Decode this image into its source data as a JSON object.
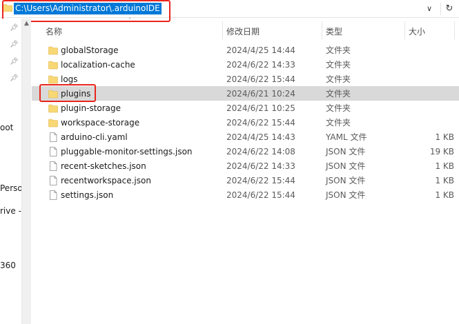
{
  "address": {
    "path": "C:\\Users\\Administrator\\.arduinoIDE"
  },
  "nav": {
    "items": [
      {
        "label": "oot"
      },
      {
        "label": "Perso"
      },
      {
        "label": "rive -"
      },
      {
        "label": "360"
      }
    ]
  },
  "columns": {
    "name": "名称",
    "date": "修改日期",
    "type": "类型",
    "size": "大小"
  },
  "files": [
    {
      "name": "globalStorage",
      "date": "2024/4/25 14:44",
      "type": "文件夹",
      "size": "",
      "kind": "folder"
    },
    {
      "name": "localization-cache",
      "date": "2024/6/22 14:33",
      "type": "文件夹",
      "size": "",
      "kind": "folder"
    },
    {
      "name": "logs",
      "date": "2024/6/22 15:44",
      "type": "文件夹",
      "size": "",
      "kind": "folder"
    },
    {
      "name": "plugins",
      "date": "2024/6/21 10:24",
      "type": "文件夹",
      "size": "",
      "kind": "folder"
    },
    {
      "name": "plugin-storage",
      "date": "2024/6/21 10:25",
      "type": "文件夹",
      "size": "",
      "kind": "folder"
    },
    {
      "name": "workspace-storage",
      "date": "2024/6/22 15:44",
      "type": "文件夹",
      "size": "",
      "kind": "folder"
    },
    {
      "name": "arduino-cli.yaml",
      "date": "2024/4/25 14:43",
      "type": "YAML 文件",
      "size": "1 KB",
      "kind": "file"
    },
    {
      "name": "pluggable-monitor-settings.json",
      "date": "2024/6/22 14:08",
      "type": "JSON 文件",
      "size": "19 KB",
      "kind": "file"
    },
    {
      "name": "recent-sketches.json",
      "date": "2024/6/22 14:33",
      "type": "JSON 文件",
      "size": "1 KB",
      "kind": "file"
    },
    {
      "name": "recentworkspace.json",
      "date": "2024/6/22 15:44",
      "type": "JSON 文件",
      "size": "1 KB",
      "kind": "file"
    },
    {
      "name": "settings.json",
      "date": "2024/6/22 15:44",
      "type": "JSON 文件",
      "size": "1 KB",
      "kind": "file"
    }
  ],
  "selected_index": 3,
  "colors": {
    "folder": "#f8d775",
    "folder_dark": "#e8b94a",
    "highlight": "#e8241c",
    "selection": "#d9d9d9",
    "address_selection": "#0078d7"
  },
  "icons": {
    "folder": "folder-icon",
    "file": "file-icon",
    "pin": "pin-icon"
  }
}
